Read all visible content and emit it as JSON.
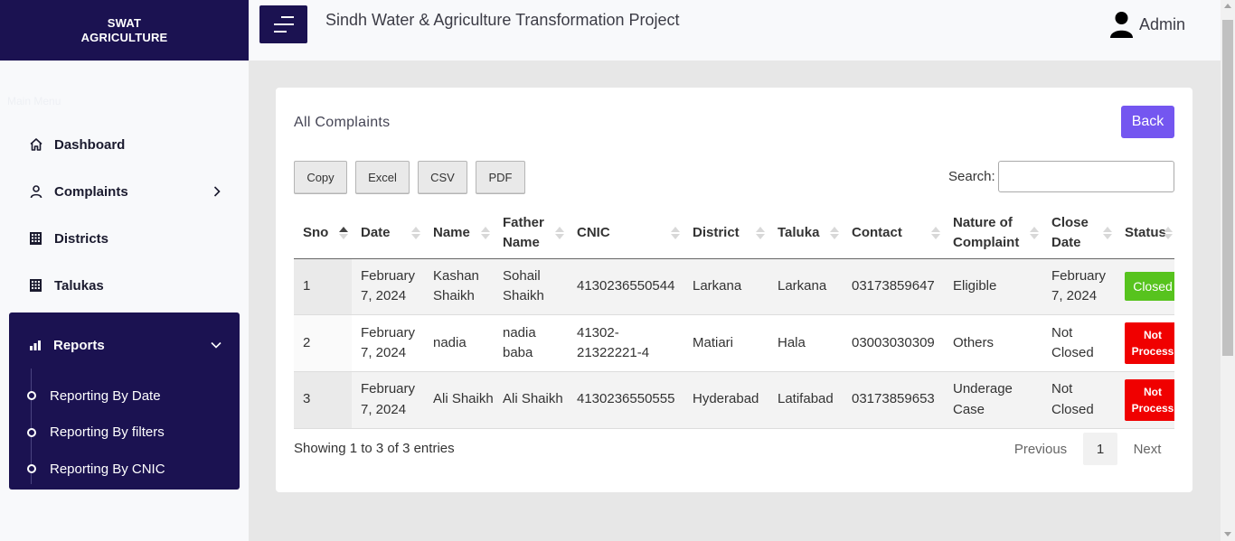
{
  "brand": {
    "line1": "SWAT",
    "line2": "AGRICULTURE"
  },
  "sidebar": {
    "menu_header": "Main Menu",
    "items": [
      {
        "label": "Dashboard",
        "icon": "home-icon"
      },
      {
        "label": "Complaints",
        "icon": "user-icon"
      },
      {
        "label": "Districts",
        "icon": "building-icon"
      },
      {
        "label": "Talukas",
        "icon": "building-icon"
      }
    ],
    "reports": {
      "label": "Reports",
      "icon": "bar-chart-icon",
      "subitems": [
        "Reporting By Date",
        "Reporting By filters",
        "Reporting By CNIC"
      ]
    }
  },
  "header": {
    "title": "Sindh Water & Agriculture Transformation Project",
    "user": "Admin"
  },
  "card": {
    "title": "All Complaints",
    "back_label": "Back",
    "export_buttons": [
      "Copy",
      "Excel",
      "CSV",
      "PDF"
    ],
    "search_label": "Search:",
    "search_value": ""
  },
  "table": {
    "columns": [
      "Sno",
      "Date",
      "Name",
      "Father Name",
      "CNIC",
      "District",
      "Taluka",
      "Contact",
      "Nature of Complaint",
      "Close Date",
      "Status"
    ],
    "rows": [
      {
        "sno": "1",
        "date": "February 7, 2024",
        "name": "Kashan Shaikh",
        "father": "Sohail Shaikh",
        "cnic": "4130236550544",
        "district": "Larkana",
        "taluka": "Larkana",
        "contact": "03173859647",
        "nature": "Eligible",
        "close_date": "February 7, 2024",
        "status": "Closed"
      },
      {
        "sno": "2",
        "date": "February 7, 2024",
        "name": "nadia",
        "father": "nadia baba",
        "cnic": "41302-21322221-4",
        "district": "Matiari",
        "taluka": "Hala",
        "contact": "03003030309",
        "nature": "Others",
        "close_date": "Not Closed",
        "status": "Not Process"
      },
      {
        "sno": "3",
        "date": "February 7, 2024",
        "name": "Ali Shaikh",
        "father": "Ali Shaikh",
        "cnic": "4130236550555",
        "district": "Hyderabad",
        "taluka": "Latifabad",
        "contact": "03173859653",
        "nature": "Underage Case",
        "close_date": "Not Closed",
        "status": "Not Process"
      }
    ]
  },
  "footer": {
    "info": "Showing 1 to 3 of 3 entries",
    "previous": "Previous",
    "page": "1",
    "next": "Next"
  },
  "colors": {
    "brand": "#1b1251",
    "accent": "#7456f0",
    "closed": "#57c31e",
    "not_process": "#f00000"
  }
}
